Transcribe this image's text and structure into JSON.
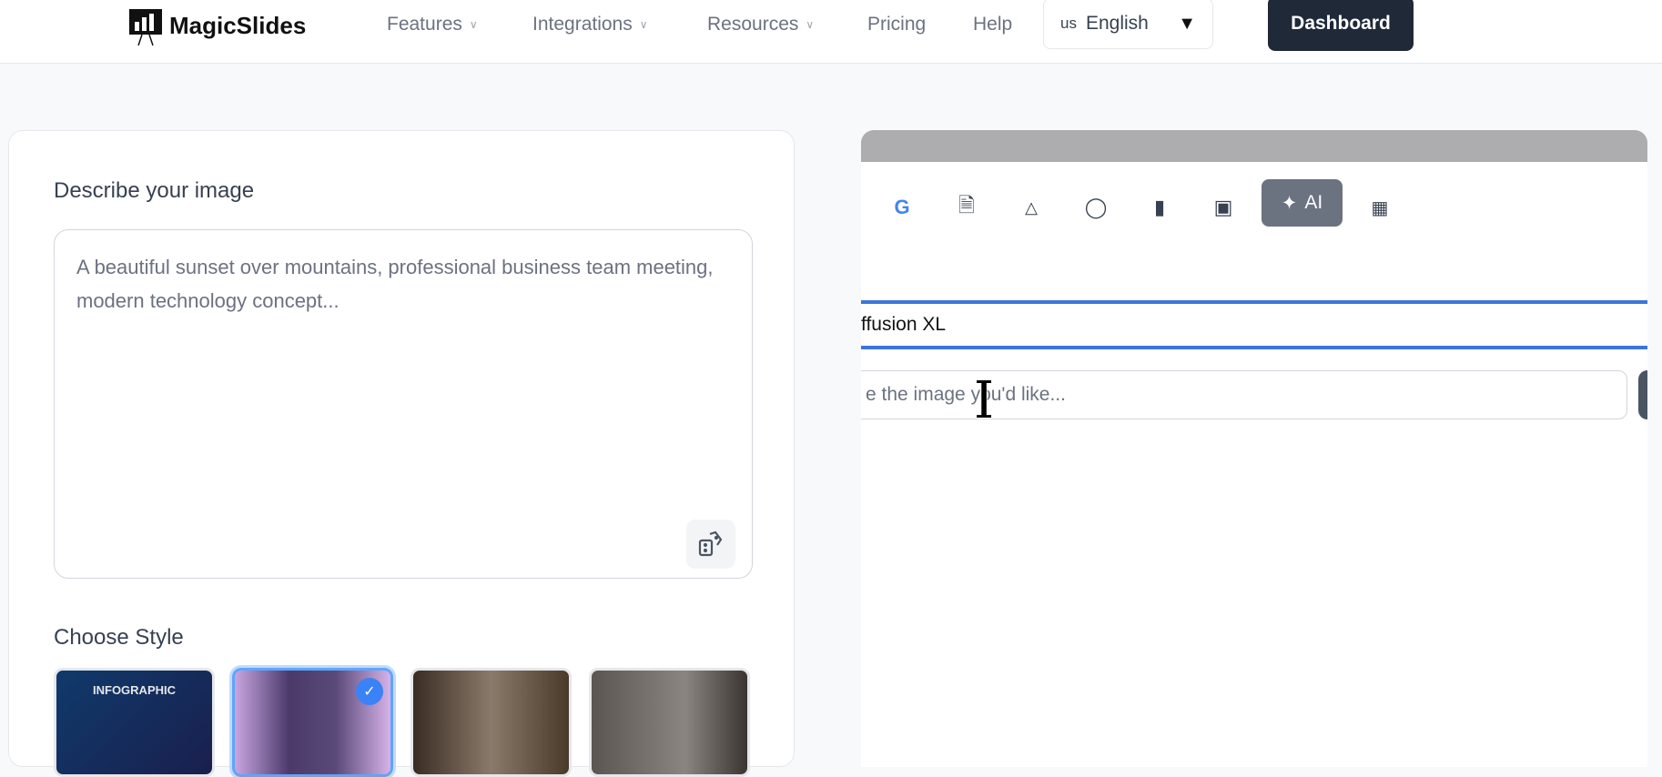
{
  "nav": {
    "brand": "MagicSlides",
    "items": [
      {
        "label": "Features",
        "dropdown": true
      },
      {
        "label": "Integrations",
        "dropdown": true
      },
      {
        "label": "Resources",
        "dropdown": true
      },
      {
        "label": "Pricing"
      },
      {
        "label": "Help"
      }
    ],
    "language": {
      "code": "us",
      "label": "English"
    },
    "dashboard": "Dashboard"
  },
  "left": {
    "describe_label": "Describe your image",
    "prompt_placeholder": "A beautiful sunset over mountains, professional business team meeting, modern technology concept...",
    "style_label": "Choose Style",
    "styles": [
      {
        "label": "INFOGRAPHIC"
      },
      {
        "label": ""
      },
      {
        "label": ""
      },
      {
        "label": ""
      }
    ]
  },
  "right": {
    "ai_label": "AI",
    "model": "ffusion XL",
    "prompt_placeholder": "e the image you'd like..."
  },
  "colors": {
    "accent": "#3b76d8",
    "dark": "#1f2937",
    "ai_button": "#6b7280"
  }
}
